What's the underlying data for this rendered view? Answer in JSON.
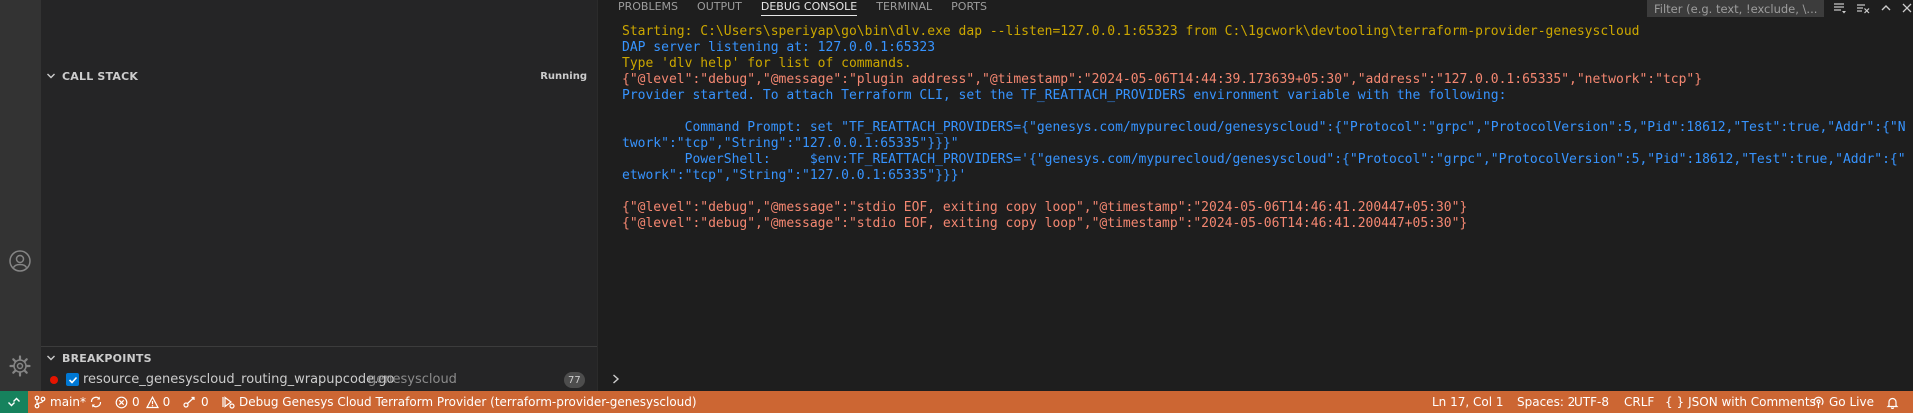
{
  "sidebar": {
    "call_stack": {
      "title": "CALL STACK",
      "status": "Running"
    },
    "breakpoints": {
      "title": "BREAKPOINTS",
      "items": [
        {
          "file": "resource_genesyscloud_routing_wrapupcode.go",
          "folder": "genesyscloud",
          "line": "77"
        }
      ]
    }
  },
  "panel": {
    "tabs": [
      {
        "label": "PROBLEMS"
      },
      {
        "label": "OUTPUT"
      },
      {
        "label": "DEBUG CONSOLE"
      },
      {
        "label": "TERMINAL"
      },
      {
        "label": "PORTS"
      }
    ],
    "active_tab": "DEBUG CONSOLE",
    "filter_placeholder": "Filter (e.g. text, !exclude, \\..."
  },
  "console": {
    "lines": [
      {
        "kind": "warn",
        "text": "Starting: C:\\Users\\speriyap\\go\\bin\\dlv.exe dap --listen=127.0.0.1:65323 from C:\\1gcwork\\devtooling\\terraform-provider-genesyscloud"
      },
      {
        "kind": "info",
        "text": "DAP server listening at: 127.0.0.1:65323"
      },
      {
        "kind": "warn",
        "text": "Type 'dlv help' for list of commands."
      },
      {
        "kind": "log",
        "text": "{\"@level\":\"debug\",\"@message\":\"plugin address\",\"@timestamp\":\"2024-05-06T14:44:39.173639+05:30\",\"address\":\"127.0.0.1:65335\",\"network\":\"tcp\"}"
      },
      {
        "kind": "info",
        "text": "Provider started. To attach Terraform CLI, set the TF_REATTACH_PROVIDERS environment variable with the following:"
      },
      {
        "kind": "info",
        "text": ""
      },
      {
        "kind": "info",
        "text": "        Command Prompt: set \"TF_REATTACH_PROVIDERS={\"genesys.com/mypurecloud/genesyscloud\":{\"Protocol\":\"grpc\",\"ProtocolVersion\":5,\"Pid\":18612,\"Test\":true,\"Addr\":{\"Ne"
      },
      {
        "kind": "info",
        "text": "twork\":\"tcp\",\"String\":\"127.0.0.1:65335\"}}}\""
      },
      {
        "kind": "info",
        "text": "        PowerShell:     $env:TF_REATTACH_PROVIDERS='{\"genesys.com/mypurecloud/genesyscloud\":{\"Protocol\":\"grpc\",\"ProtocolVersion\":5,\"Pid\":18612,\"Test\":true,\"Addr\":{\"N"
      },
      {
        "kind": "info",
        "text": "etwork\":\"tcp\",\"String\":\"127.0.0.1:65335\"}}}'"
      },
      {
        "kind": "info",
        "text": ""
      },
      {
        "kind": "log",
        "text": "{\"@level\":\"debug\",\"@message\":\"stdio EOF, exiting copy loop\",\"@timestamp\":\"2024-05-06T14:46:41.200447+05:30\"}"
      },
      {
        "kind": "log",
        "text": "{\"@level\":\"debug\",\"@message\":\"stdio EOF, exiting copy loop\",\"@timestamp\":\"2024-05-06T14:46:41.200447+05:30\"}"
      }
    ],
    "colors": {
      "warn": "#cca700",
      "info": "#3794ff",
      "log": "#f48771"
    }
  },
  "statusbar": {
    "branch": "main*",
    "errors": "0",
    "warnings": "0",
    "ports": "0",
    "debug_label": "Debug Genesys Cloud Terraform Provider (terraform-provider-genesyscloud)",
    "position": "Ln 17, Col 1",
    "spaces": "Spaces: 2",
    "encoding": "UTF-8",
    "eol": "CRLF",
    "language": "JSON with Comments",
    "go_live": "Go Live",
    "background": "#cc6633",
    "remote_background": "#16825d"
  },
  "icons": {
    "activity": [
      "accounts-icon",
      "manage-gear-icon"
    ],
    "panel_tools": [
      "filter-options-icon",
      "clear-console-icon",
      "maximize-panel-icon",
      "close-panel-icon"
    ],
    "status": [
      "remote-icon",
      "source-control-icon",
      "sync-icon",
      "error-icon",
      "warning-icon",
      "ports-icon",
      "debug-icon",
      "feedback-icon",
      "notifications-icon"
    ]
  }
}
